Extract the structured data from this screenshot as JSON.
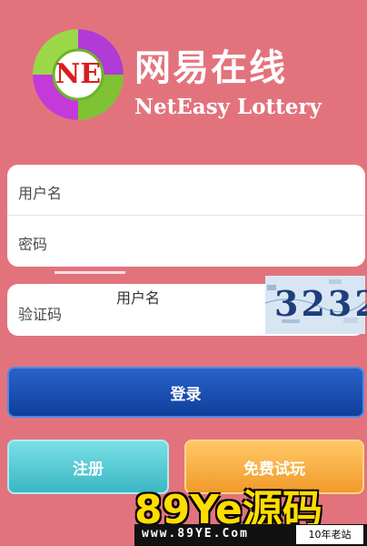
{
  "brand": {
    "badge_text": "NE",
    "name_cn": "网易在线",
    "name_en": "NetEasy Lottery"
  },
  "form": {
    "username_placeholder": "用户名",
    "password_placeholder": "密码",
    "captcha_placeholder": "验证码",
    "captcha_code": "3232",
    "ghost_label": "用户名"
  },
  "buttons": {
    "login": "登录",
    "register": "注册",
    "trial": "免费试玩"
  },
  "watermark": {
    "logo": "89Ye源码",
    "url": "www.89YE.Com",
    "badge": "10年老站"
  },
  "colors": {
    "background": "#e2737d",
    "login_button": "#1a4fb0",
    "register_button": "#5ccdd6",
    "trial_button": "#f7ad45"
  }
}
